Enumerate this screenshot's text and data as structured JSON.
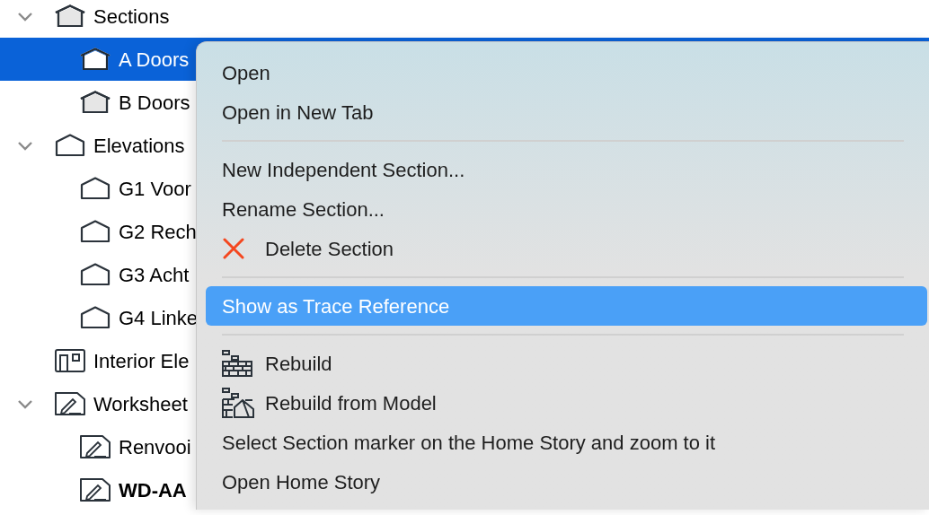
{
  "tree": [
    {
      "label": "Sections",
      "kind": "section",
      "expanded": true,
      "selected": false,
      "children": [
        {
          "label": "A Doors",
          "kind": "section",
          "selected": true
        },
        {
          "label": "B Doors",
          "kind": "section",
          "selected": false
        }
      ]
    },
    {
      "label": "Elevations",
      "kind": "elevation",
      "expanded": true,
      "selected": false,
      "children": [
        {
          "label": "G1 Voor",
          "kind": "elevation",
          "selected": false
        },
        {
          "label": "G2 Rech",
          "kind": "elevation",
          "selected": false
        },
        {
          "label": "G3 Acht",
          "kind": "elevation",
          "selected": false
        },
        {
          "label": "G4 Linke",
          "kind": "elevation",
          "selected": false
        }
      ]
    },
    {
      "label": "Interior Ele",
      "kind": "interior",
      "selected": false
    },
    {
      "label": "Worksheet",
      "kind": "worksheet",
      "expanded": true,
      "selected": false,
      "children": [
        {
          "label": "Renvooi",
          "kind": "worksheet",
          "selected": false
        },
        {
          "label": "WD-AA",
          "kind": "worksheet",
          "selected": false,
          "emphasized": true
        }
      ]
    }
  ],
  "context_menu": [
    {
      "kind": "item",
      "label": "Open",
      "selected": false
    },
    {
      "kind": "item",
      "label": "Open in New Tab",
      "selected": false
    },
    {
      "kind": "separator"
    },
    {
      "kind": "item",
      "label": "New Independent Section...",
      "selected": false
    },
    {
      "kind": "item",
      "label": "Rename Section...",
      "selected": false
    },
    {
      "kind": "delete",
      "label": "Delete Section",
      "selected": false
    },
    {
      "kind": "separator"
    },
    {
      "kind": "item",
      "label": "Show as Trace Reference",
      "selected": true
    },
    {
      "kind": "separator"
    },
    {
      "kind": "rebuild",
      "label": "Rebuild",
      "selected": false
    },
    {
      "kind": "rebuild-model",
      "label": "Rebuild from Model",
      "selected": false
    },
    {
      "kind": "item",
      "label": "Select Section marker on the Home Story and zoom to it",
      "selected": false
    },
    {
      "kind": "item",
      "label": "Open Home Story",
      "selected": false
    }
  ]
}
